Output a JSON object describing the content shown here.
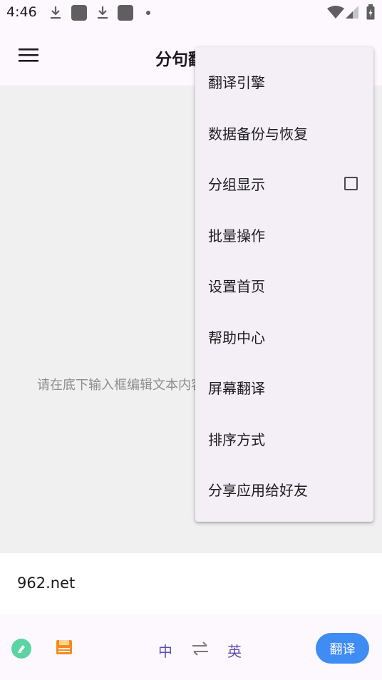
{
  "status_bar": {
    "time": "4:46",
    "icons": [
      "download-icon",
      "app-icon",
      "download-icon",
      "app-icon",
      "dot-icon",
      "wifi-icon",
      "signal-icon",
      "battery-icon"
    ]
  },
  "app_bar": {
    "title": "分句翻译"
  },
  "content": {
    "hint": "请在底下输入框编辑文本内容"
  },
  "input": {
    "value": "962.net"
  },
  "bottom_bar": {
    "source_lang": "中",
    "target_lang": "英",
    "translate_label": "翻译"
  },
  "menu": {
    "items": [
      {
        "label": "翻译引擎"
      },
      {
        "label": "数据备份与恢复"
      },
      {
        "label": "分组显示",
        "checkbox": false
      },
      {
        "label": "批量操作"
      },
      {
        "label": "设置首页"
      },
      {
        "label": "帮助中心"
      },
      {
        "label": "屏幕翻译"
      },
      {
        "label": "排序方式"
      },
      {
        "label": "分享应用给好友"
      }
    ]
  },
  "colors": {
    "accent": "#3f8cf5",
    "language_text": "#5b4fb0",
    "menu_bg": "#f4eff6",
    "content_bg": "#f0f0f0"
  }
}
